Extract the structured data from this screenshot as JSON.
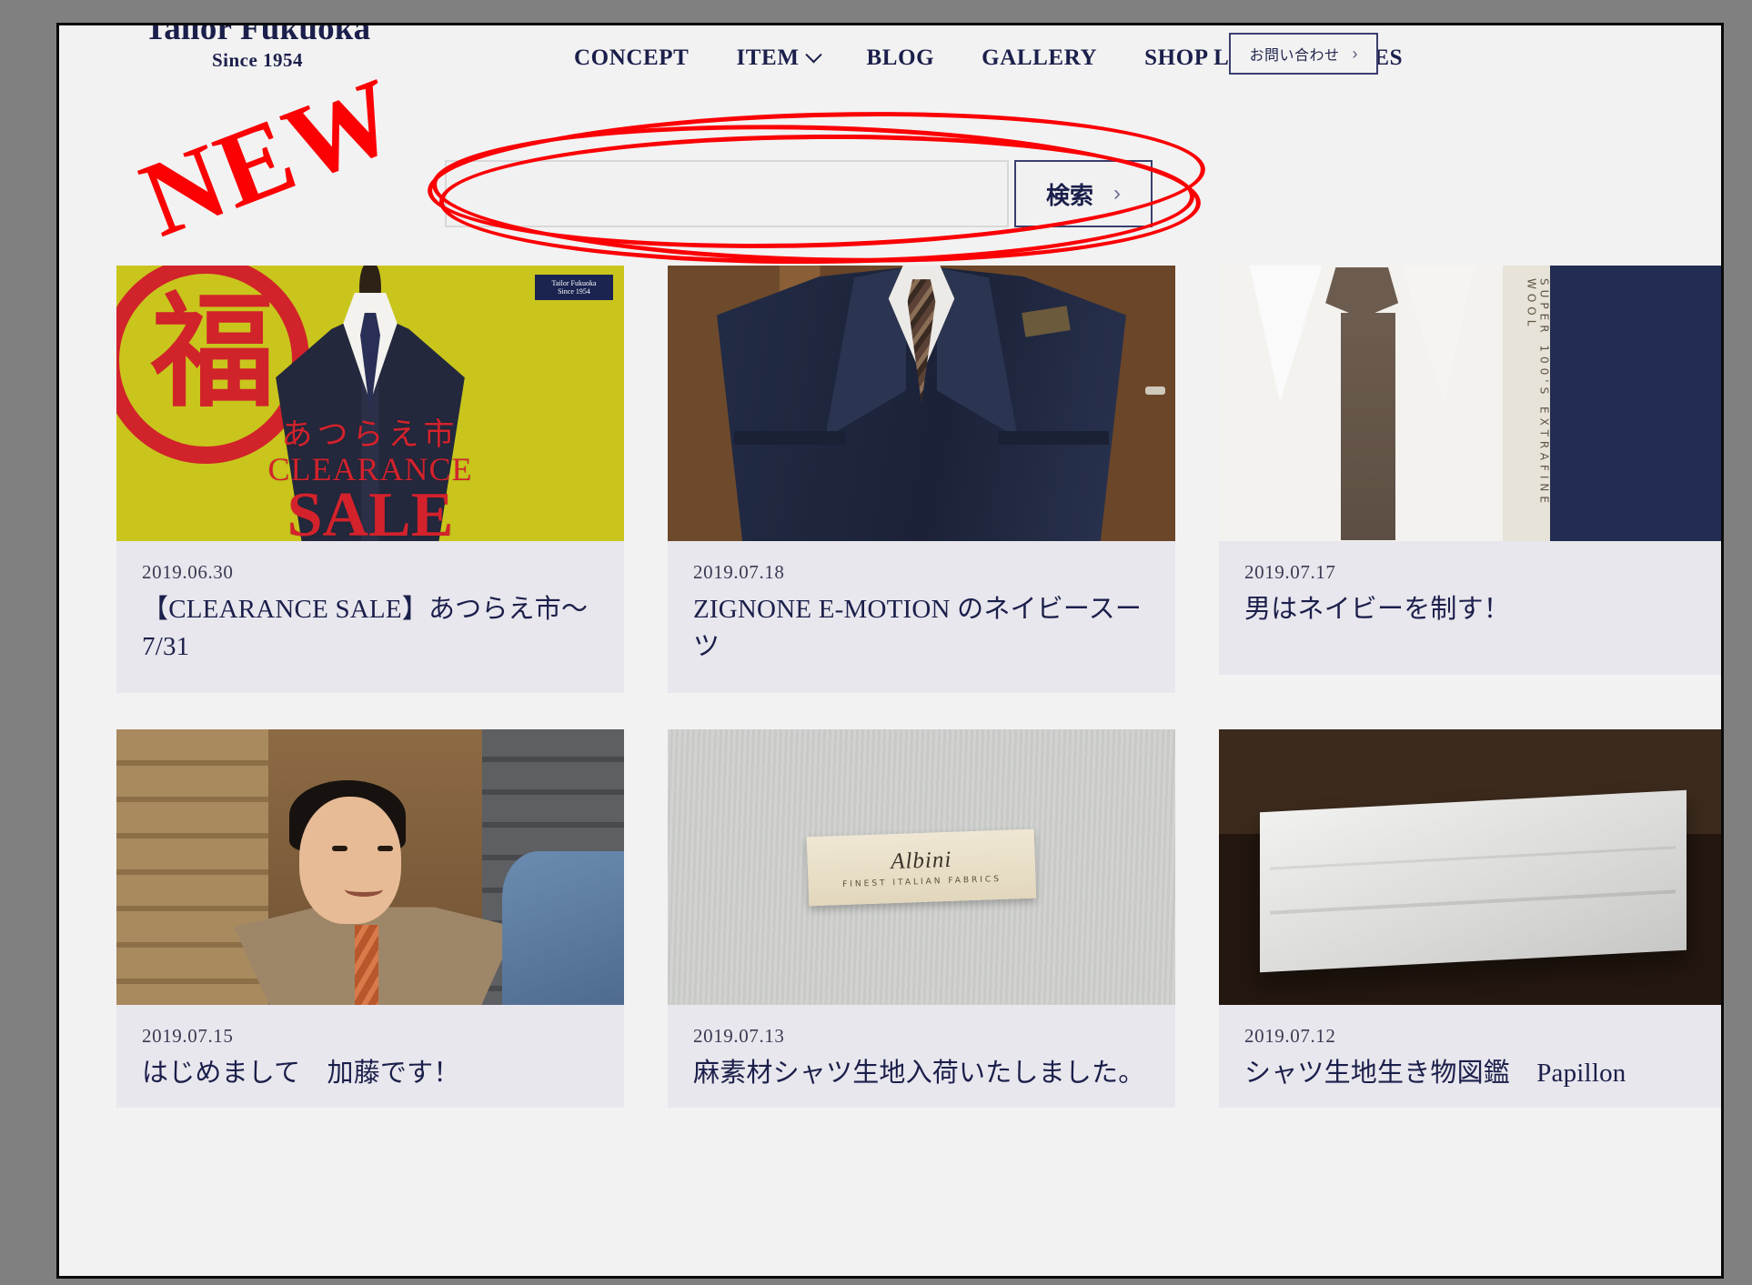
{
  "header": {
    "brand_name": "Tailor Fukuoka",
    "brand_since": "Since 1954",
    "nav": [
      {
        "label": "CONCEPT",
        "has_dropdown": false
      },
      {
        "label": "ITEM",
        "has_dropdown": true
      },
      {
        "label": "BLOG",
        "has_dropdown": false
      },
      {
        "label": "GALLERY",
        "has_dropdown": false
      },
      {
        "label": "SHOP LIST",
        "has_dropdown": false
      },
      {
        "label": "LADIES",
        "has_dropdown": false
      }
    ],
    "contact_button": {
      "label": "お問い合わせ",
      "arrow": "›"
    }
  },
  "search": {
    "value": "",
    "placeholder": "",
    "button_label": "検索",
    "button_arrow": "›"
  },
  "cards": [
    {
      "date": "2019.06.30",
      "title": "【CLEARANCE SALE】あつらえ市〜7/31",
      "thumb": "clearance-sale-poster",
      "poster": {
        "kanji": "福",
        "line_ja": "あつらえ市",
        "line_clearance": "CLEARANCE",
        "line_sale": "SALE",
        "tag_brand": "Tailor Fukuoka",
        "tag_since": "Since 1954"
      }
    },
    {
      "date": "2019.07.18",
      "title": "ZIGNONE E-MOTION のネイビースーツ",
      "thumb": "navy-suit-photo"
    },
    {
      "date": "2019.07.17",
      "title": "男はネイビーを制す！",
      "thumb": "brown-tie-navy-fabric",
      "selvedge_text": "SUPER 100'S EXTRAFINE WOOL"
    },
    {
      "date": "2019.07.15",
      "title": "はじめまして　加藤です！",
      "thumb": "shop-staff-portrait"
    },
    {
      "date": "2019.07.13",
      "title": "麻素材シャツ生地入荷いたしました。",
      "thumb": "albini-linen-label",
      "label": {
        "main": "Albini",
        "sub": "FINEST ITALIAN FABRICS"
      }
    },
    {
      "date": "2019.07.12",
      "title": "シャツ生地生き物図鑑　Papillon",
      "thumb": "folded-white-fabric"
    }
  ],
  "annotations": {
    "new_label": "NEW",
    "highlight_color": "#fb0104",
    "highlight_target": "search-row"
  },
  "colors": {
    "navy": "#1b1f4b",
    "page_background": "#f2f2f2",
    "card_background": "#e8e7ed",
    "desktop_background": "#808080",
    "annotation_red": "#fb0104"
  }
}
